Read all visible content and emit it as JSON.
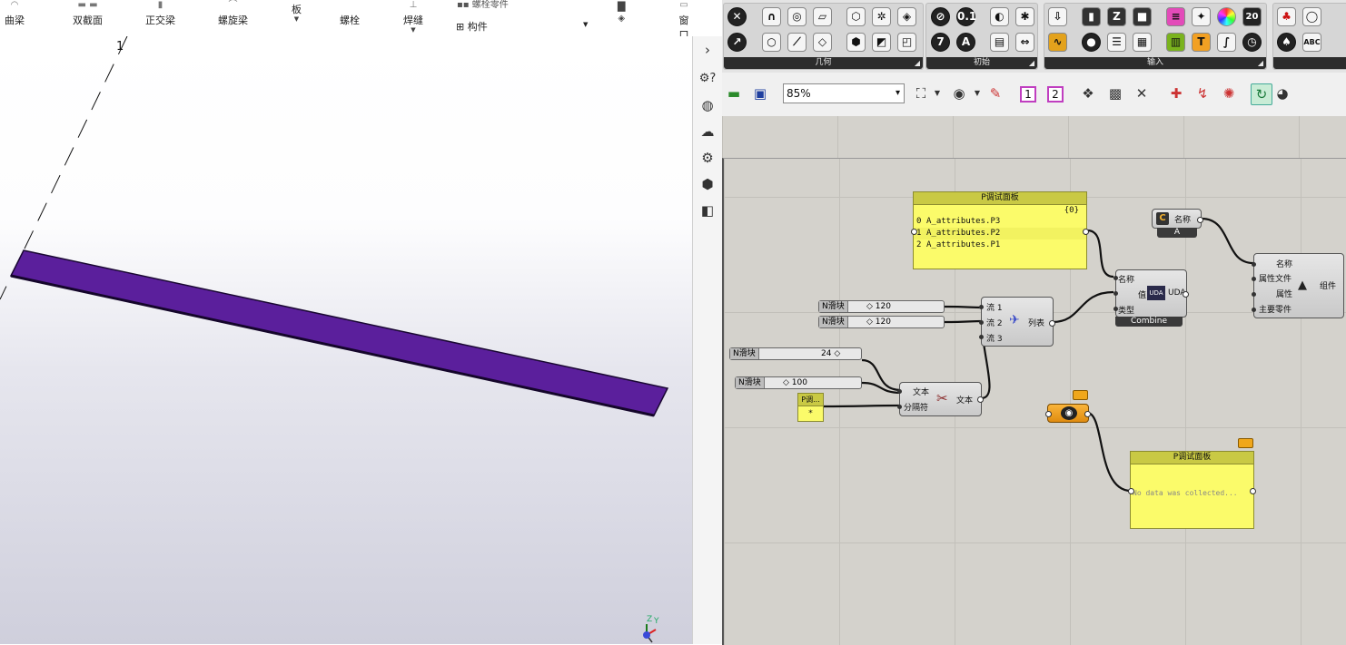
{
  "tekla": {
    "ribbon": [
      {
        "label": "曲梁"
      },
      {
        "label": "双截面"
      },
      {
        "label": "正交梁"
      },
      {
        "label": "螺旋梁"
      },
      {
        "label": "板"
      },
      {
        "label": "螺栓"
      },
      {
        "label": "焊缝"
      },
      {
        "label": "螺栓零件"
      },
      {
        "label": "构件"
      },
      {
        "label": "窗口"
      }
    ],
    "viewport": {
      "grid_label": "1",
      "axis_z": "Z",
      "axis_y": "Y",
      "beam_color": "#5b1f9c"
    },
    "side_tools": [
      "expand-arrow",
      "settings-question",
      "globe",
      "cloud",
      "gear",
      "cube",
      "layout"
    ]
  },
  "grasshopper": {
    "tab_groups": [
      {
        "label": "几何"
      },
      {
        "label": "初始"
      },
      {
        "label": "输入"
      }
    ],
    "toolbar": {
      "zoom": "85%",
      "num1": "1",
      "num2": "2"
    },
    "panel_top": {
      "title": "P调试面板",
      "path": "{0}",
      "rows": [
        {
          "idx": "0",
          "text": "A_attributes.P3"
        },
        {
          "idx": "1",
          "text": "A_attributes.P2"
        },
        {
          "idx": "2",
          "text": "A_attributes.P1"
        }
      ]
    },
    "panel_bottom": {
      "title": "P调试面板",
      "text": "No data was collected..."
    },
    "panel_small": {
      "title": "P调...",
      "value": "*"
    },
    "sliders": [
      {
        "tag": "N滑块",
        "value": "120"
      },
      {
        "tag": "N滑块",
        "value": "120"
      },
      {
        "tag": "N滑块",
        "value": "24"
      },
      {
        "tag": "N滑块",
        "value": "100"
      }
    ],
    "list_comp": {
      "in1": "流 1",
      "in2": "流 2",
      "in3": "流 3",
      "out": "列表"
    },
    "text_comp": {
      "in1": "文本",
      "in2": "分隔符",
      "out": "文本"
    },
    "uda_comp": {
      "in1": "名称",
      "in2": "值",
      "in3": "类型",
      "icon": "UDA",
      "out": "UDA",
      "footer": "Combine"
    },
    "name_param": {
      "icon": "C",
      "label": "名称",
      "footer": "A"
    },
    "component_comp": {
      "in1": "名称",
      "in2": "属性文件",
      "in3": "属性",
      "in4": "主要零件",
      "out": "组件"
    }
  }
}
